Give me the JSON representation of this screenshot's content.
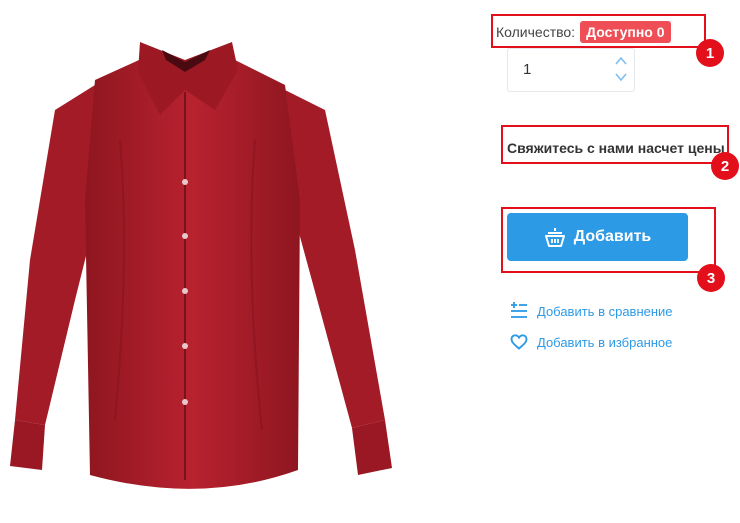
{
  "quantity": {
    "label": "Количество:",
    "badge": "Доступно 0",
    "value": "1"
  },
  "price_note": "Свяжитесь с нами насчет цены",
  "add_button": {
    "label": "Добавить",
    "icon": "basket-icon"
  },
  "links": {
    "compare": {
      "label": "Добавить в сравнение",
      "icon": "compare-list-icon"
    },
    "favorite": {
      "label": "Добавить в избранное",
      "icon": "heart-icon"
    }
  },
  "annotations": [
    "1",
    "2",
    "3"
  ],
  "colors": {
    "accent": "#2d9ae6",
    "badge": "#f04e56",
    "annotation": "#e3101b",
    "shirt": "#b0202c"
  }
}
